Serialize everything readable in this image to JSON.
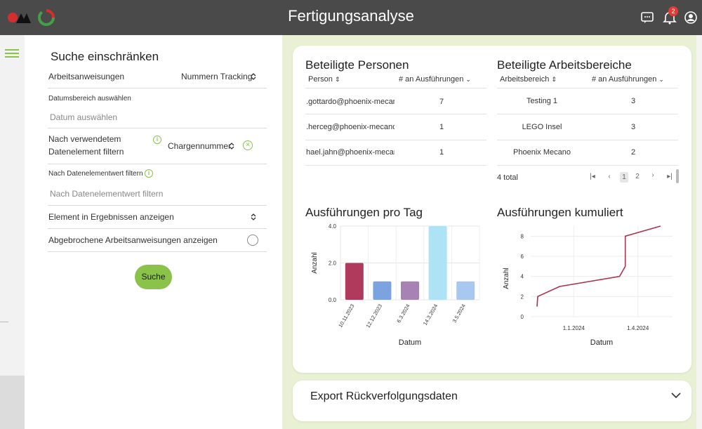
{
  "header": {
    "title": "Fertigungsanalyse",
    "notification_count": "2",
    "icons": [
      "chat-icon",
      "notifications-icon",
      "account-icon"
    ]
  },
  "colors": {
    "accent": "#8bc34a",
    "header_bg": "#4a4a4a",
    "right_bg": "#e8f1d4"
  },
  "filter": {
    "title": "Suche einschränken",
    "workinstructions_label": "Arbeitsanweisungen",
    "tracking_value": "Nummern Tracking",
    "date_label": "Datumsbereich auswählen",
    "date_placeholder": "Datum auswählen",
    "data_element_label_1": "Nach verwendetem",
    "data_element_label_2": "Datenelement filtern",
    "data_element_value": "Chargennummer",
    "data_value_label": "Nach Datenelementwert filtern",
    "data_value_placeholder": "Nach Datenelementwert filtern",
    "show_element_label": "Element in Ergebnissen anzeigen",
    "aborted_label": "Abgebrochene Arbeitsanweisungen anzeigen",
    "search_button": "Suche"
  },
  "persons": {
    "title": "Beteiligte Personen",
    "col_person": "Person",
    "col_count": "# an Ausführungen",
    "rows": [
      {
        "person": ".gottardo@phoenix-mecano.com",
        "count": "7"
      },
      {
        "person": ".herceg@phoenix-mecano.com",
        "count": "1"
      },
      {
        "person": "hael.jahn@phoenix-mecano.com",
        "count": "1"
      }
    ]
  },
  "areas": {
    "title": "Beteiligte Arbeitsbereiche",
    "col_area": "Arbeitsbereich",
    "col_count": "# an Ausführungen",
    "rows": [
      {
        "area": "Testing 1",
        "count": "3"
      },
      {
        "area": "LEGO Insel",
        "count": "3"
      },
      {
        "area": "Phoenix Mecano",
        "count": "2"
      }
    ],
    "total": "4 total",
    "pages": [
      "1",
      "2"
    ],
    "active_page": "1"
  },
  "export": {
    "title": "Export Rückverfolgungsdaten"
  },
  "chart_data": [
    {
      "type": "bar",
      "title": "Ausführungen pro Tag",
      "xlabel": "Datum",
      "ylabel": "Anzahl",
      "categories": [
        "10.11.2023",
        "12.12.2023",
        "6.3.2024",
        "14.3.2024",
        "3.5.2024"
      ],
      "values": [
        2,
        1,
        1,
        4,
        1
      ],
      "colors": [
        "#b03a5b",
        "#7ba3e0",
        "#a683b3",
        "#aee3f5",
        "#a9c8ef"
      ],
      "yticks": [
        "0.0",
        "2.0",
        "4.0"
      ],
      "ylim": [
        0,
        4
      ],
      "grid": true
    },
    {
      "type": "line",
      "title": "Ausführungen kumuliert",
      "xlabel": "Datum",
      "ylabel": "Anzahl",
      "xticks": [
        "1.1.2024",
        "1.4.2024"
      ],
      "yticks": [
        "0",
        "2",
        "4",
        "6",
        "8"
      ],
      "ylim": [
        0,
        9
      ],
      "series": [
        {
          "color": "#a8344f",
          "points": [
            [
              "10.11.2023",
              1
            ],
            [
              "11.11.2023",
              2
            ],
            [
              "12.12.2023",
              3
            ],
            [
              "6.3.2024",
              4
            ],
            [
              "14.3.2024",
              5
            ],
            [
              "14.3.2024",
              8
            ],
            [
              "3.5.2024",
              9
            ]
          ]
        }
      ],
      "grid": true
    }
  ]
}
